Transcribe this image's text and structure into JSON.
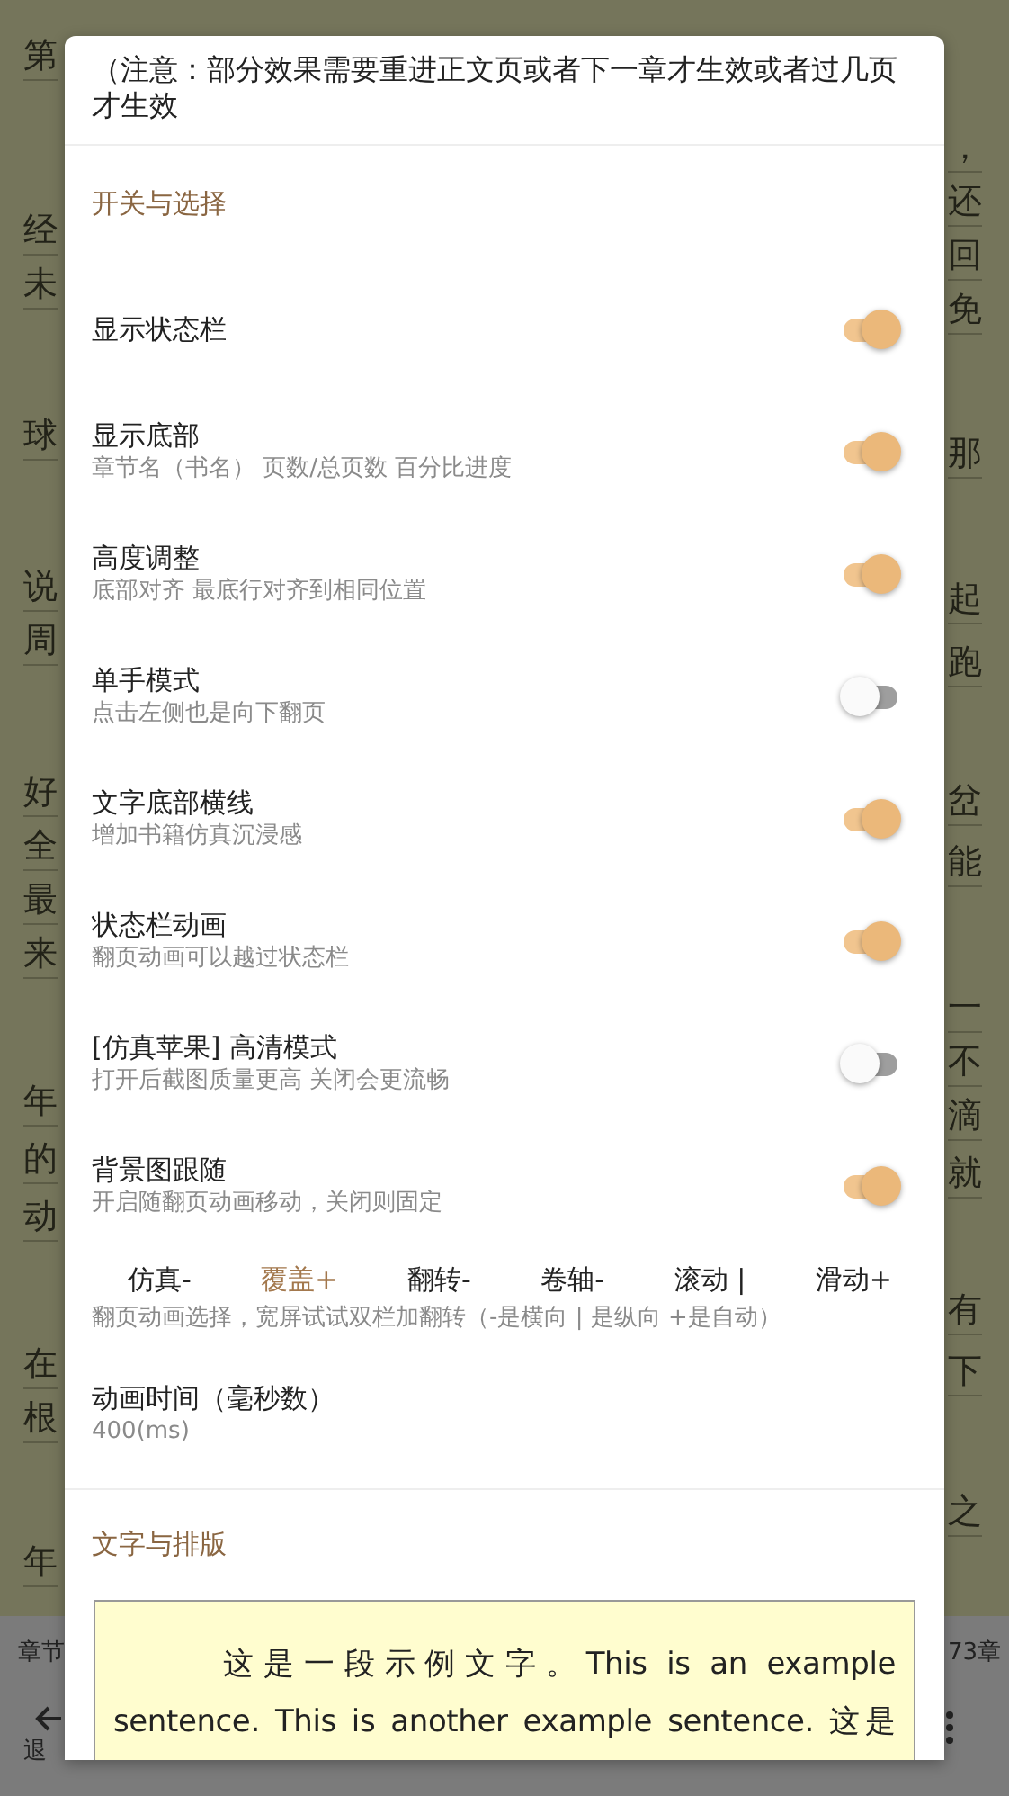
{
  "backdrop": {
    "left_column": [
      "第",
      "经",
      "未",
      "球",
      "说",
      "周",
      "好",
      "全",
      "最",
      "来",
      "年",
      "的",
      "动",
      "在",
      "根",
      "年"
    ],
    "right_column": [
      "，",
      "还",
      "回",
      "免",
      "那",
      "起",
      "跑",
      "岔",
      "能",
      "一",
      "不",
      "滴",
      "就",
      "有",
      "下",
      "之"
    ],
    "bottom_bar": {
      "chapter_label": "章节",
      "chapter_count": "73章",
      "exit_label": "退"
    }
  },
  "dialog": {
    "notice": "（注意：部分效果需要重进正文页或者下一章才生效或者过几页才生效",
    "sections": [
      {
        "title": "开关与选择",
        "items": [
          {
            "kind": "switch",
            "title": "显示状态栏",
            "on": true
          },
          {
            "kind": "switch",
            "title": "显示底部",
            "subtitle": "章节名（书名） 页数/总页数 百分比进度",
            "on": true
          },
          {
            "kind": "switch",
            "title": "高度调整",
            "subtitle": "底部对齐 最底行对齐到相同位置",
            "on": true
          },
          {
            "kind": "switch",
            "title": "单手模式",
            "subtitle": "点击左侧也是向下翻页",
            "on": false
          },
          {
            "kind": "switch",
            "title": "文字底部横线",
            "subtitle": "增加书籍仿真沉浸感",
            "on": true
          },
          {
            "kind": "switch",
            "title": "状态栏动画",
            "subtitle": "翻页动画可以越过状态栏",
            "on": true
          },
          {
            "kind": "switch",
            "title": "[仿真苹果] 高清模式",
            "subtitle": "打开后截图质量更高 关闭会更流畅",
            "on": false
          },
          {
            "kind": "switch",
            "title": "背景图跟随",
            "subtitle": "开启随翻页动画移动，关闭则固定",
            "on": true
          },
          {
            "kind": "choices",
            "options": [
              {
                "label": "仿真-",
                "selected": false
              },
              {
                "label": "覆盖+",
                "selected": true
              },
              {
                "label": "翻转-",
                "selected": false
              },
              {
                "label": "卷轴-",
                "selected": false
              },
              {
                "label": "滚动 |",
                "selected": false
              },
              {
                "label": "滑动+",
                "selected": false
              }
            ],
            "subtitle": "翻页动画选择，宽屏试试双栏加翻转（-是横向 | 是纵向 +是自动）"
          },
          {
            "kind": "value",
            "title": "动画时间（毫秒数）",
            "value": "400(ms)"
          }
        ]
      },
      {
        "title": "文字与排版",
        "items": [
          {
            "kind": "preview",
            "text": "这是一段示例文字。This is an example sentence. This is another example sentence. 这是"
          }
        ]
      }
    ]
  }
}
